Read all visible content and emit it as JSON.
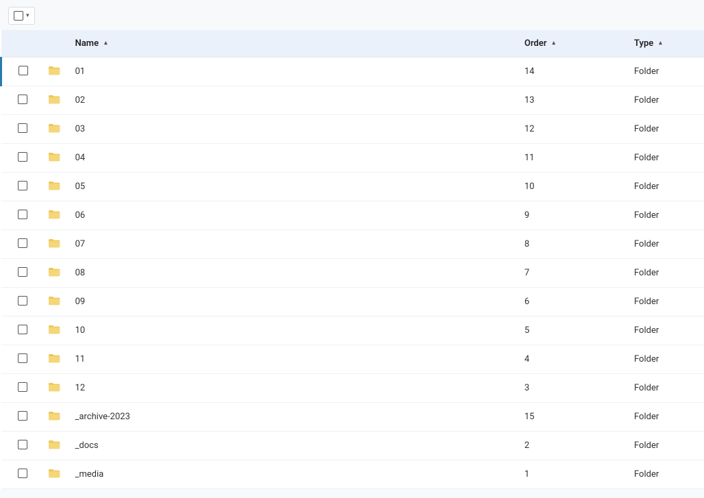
{
  "toolbar": {
    "select_all_label": "Select all"
  },
  "columns": {
    "name": "Name",
    "order": "Order",
    "type": "Type"
  },
  "rows": [
    {
      "name": "01",
      "order": "14",
      "type": "Folder"
    },
    {
      "name": "02",
      "order": "13",
      "type": "Folder"
    },
    {
      "name": "03",
      "order": "12",
      "type": "Folder"
    },
    {
      "name": "04",
      "order": "11",
      "type": "Folder"
    },
    {
      "name": "05",
      "order": "10",
      "type": "Folder"
    },
    {
      "name": "06",
      "order": "9",
      "type": "Folder"
    },
    {
      "name": "07",
      "order": "8",
      "type": "Folder"
    },
    {
      "name": "08",
      "order": "7",
      "type": "Folder"
    },
    {
      "name": "09",
      "order": "6",
      "type": "Folder"
    },
    {
      "name": "10",
      "order": "5",
      "type": "Folder"
    },
    {
      "name": "11",
      "order": "4",
      "type": "Folder"
    },
    {
      "name": "12",
      "order": "3",
      "type": "Folder"
    },
    {
      "name": "_archive-2023",
      "order": "15",
      "type": "Folder"
    },
    {
      "name": "_docs",
      "order": "2",
      "type": "Folder"
    },
    {
      "name": "_media",
      "order": "1",
      "type": "Folder"
    }
  ],
  "icons": {
    "folder_color_light": "#f5d679",
    "folder_color_dark": "#eec757"
  }
}
